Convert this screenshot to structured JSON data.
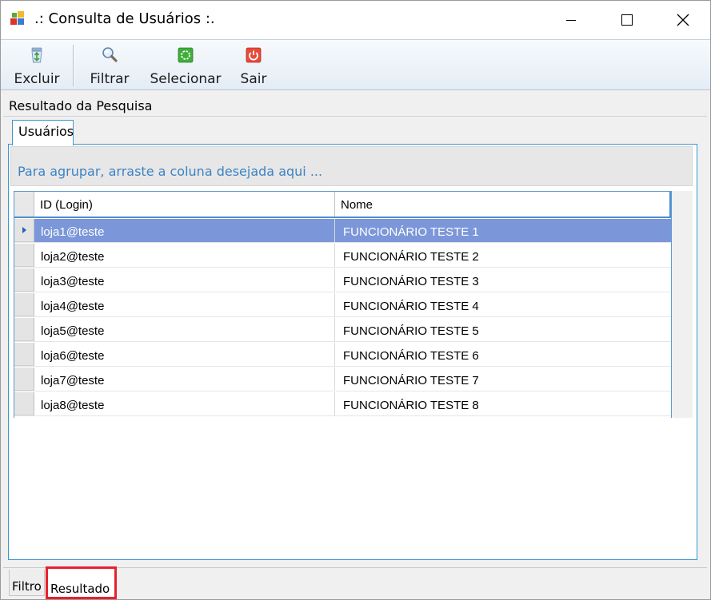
{
  "window": {
    "title": ".: Consulta de Usuários :.",
    "icon": "app-form-icon",
    "controls": {
      "minimize": "minimize-icon",
      "maximize": "maximize-icon",
      "close": "close-icon"
    }
  },
  "toolbar": {
    "buttons": [
      {
        "label": "Excluir",
        "icon": "recycle-bin-icon"
      },
      {
        "label": "Filtrar",
        "icon": "magnifier-icon"
      },
      {
        "label": "Selecionar",
        "icon": "select-green-icon"
      },
      {
        "label": "Sair",
        "icon": "power-exit-icon"
      }
    ]
  },
  "panel": {
    "title": "Resultado da Pesquisa",
    "tab": "Usuários",
    "group_hint": "Para agrupar, arraste a coluna desejada aqui ..."
  },
  "grid": {
    "columns": [
      "ID (Login)",
      "Nome"
    ],
    "rows": [
      {
        "login": "loja1@teste",
        "nome": "FUNCIONÁRIO TESTE 1",
        "selected": true
      },
      {
        "login": "loja2@teste",
        "nome": "FUNCIONÁRIO TESTE 2",
        "selected": false
      },
      {
        "login": "loja3@teste",
        "nome": "FUNCIONÁRIO TESTE 3",
        "selected": false
      },
      {
        "login": "loja4@teste",
        "nome": "FUNCIONÁRIO TESTE 4",
        "selected": false
      },
      {
        "login": "loja5@teste",
        "nome": "FUNCIONÁRIO TESTE 5",
        "selected": false
      },
      {
        "login": "loja6@teste",
        "nome": "FUNCIONÁRIO TESTE 6",
        "selected": false
      },
      {
        "login": "loja7@teste",
        "nome": "FUNCIONÁRIO TESTE 7",
        "selected": false
      },
      {
        "login": "loja8@teste",
        "nome": "FUNCIONÁRIO TESTE 8",
        "selected": false
      }
    ]
  },
  "bottom_tabs": [
    {
      "label": "Filtro",
      "active": false
    },
    {
      "label": "Resultado",
      "active": true
    }
  ],
  "colors": {
    "selected_row": "#7b97d9",
    "accent_border": "#3c96d2",
    "highlight_box": "#e8202d",
    "group_text": "#3d83c5"
  }
}
